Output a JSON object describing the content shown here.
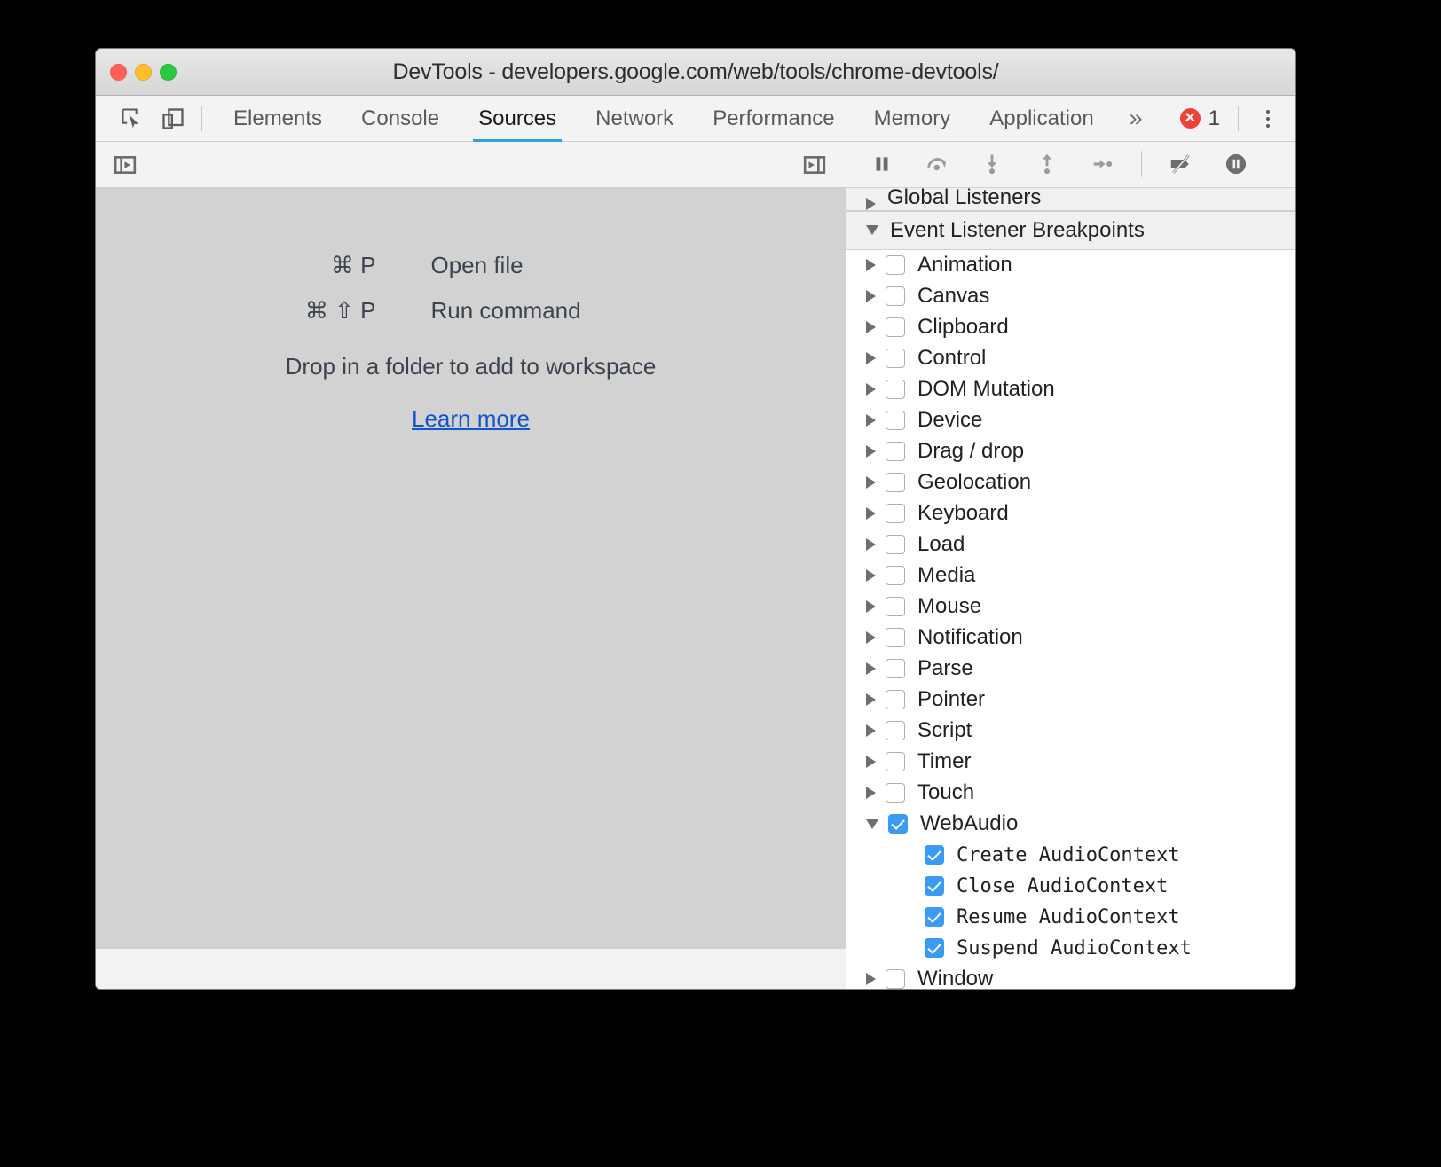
{
  "window": {
    "title": "DevTools - developers.google.com/web/tools/chrome-devtools/",
    "traffic_lights": [
      "close",
      "minimize",
      "maximize"
    ]
  },
  "colors": {
    "accent": "#29a3e0",
    "error": "#ef4136",
    "checkbox": "#3a9bf5",
    "link": "#1155cc"
  },
  "toolbar": {
    "inspect_icon": "inspect-element-icon",
    "device_icon": "device-toolbar-icon",
    "tabs": [
      {
        "label": "Elements",
        "active": false
      },
      {
        "label": "Console",
        "active": false
      },
      {
        "label": "Sources",
        "active": true
      },
      {
        "label": "Network",
        "active": false
      },
      {
        "label": "Performance",
        "active": false
      },
      {
        "label": "Memory",
        "active": false
      },
      {
        "label": "Application",
        "active": false
      }
    ],
    "more_tabs_label": "»",
    "error_count": "1",
    "error_icon": "error-circle-icon",
    "menu_icon": "kebab-menu-icon"
  },
  "editor": {
    "toolbar": {
      "show_navigator_icon": "show-navigator-panel-icon",
      "show_debugger_icon": "show-debugger-panel-icon"
    },
    "shortcuts": [
      {
        "keys": "⌘ P",
        "desc": "Open file"
      },
      {
        "keys": "⌘ ⇧ P",
        "desc": "Run command"
      }
    ],
    "drop_note": "Drop in a folder to add to workspace",
    "learn_more": "Learn more"
  },
  "debugger": {
    "buttons": [
      {
        "name": "resume-script-execution",
        "icon": "pause-icon"
      },
      {
        "name": "step-over-next-function-call",
        "icon": "step-over-icon"
      },
      {
        "name": "step-into-next-function-call",
        "icon": "step-into-icon"
      },
      {
        "name": "step-out-of-current-function",
        "icon": "step-out-icon"
      },
      {
        "name": "step",
        "icon": "step-icon"
      },
      {
        "name": "deactivate-breakpoints",
        "icon": "deactivate-breakpoints-icon"
      },
      {
        "name": "pause-on-exceptions",
        "icon": "pause-on-exceptions-icon"
      }
    ],
    "sections": [
      {
        "label": "Global Listeners",
        "expanded": false,
        "clipped": true
      },
      {
        "label": "Event Listener Breakpoints",
        "expanded": true,
        "clipped": false
      }
    ],
    "event_breakpoints": [
      {
        "label": "Animation",
        "checked": false,
        "expanded": false,
        "children": []
      },
      {
        "label": "Canvas",
        "checked": false,
        "expanded": false,
        "children": []
      },
      {
        "label": "Clipboard",
        "checked": false,
        "expanded": false,
        "children": []
      },
      {
        "label": "Control",
        "checked": false,
        "expanded": false,
        "children": []
      },
      {
        "label": "DOM Mutation",
        "checked": false,
        "expanded": false,
        "children": []
      },
      {
        "label": "Device",
        "checked": false,
        "expanded": false,
        "children": []
      },
      {
        "label": "Drag / drop",
        "checked": false,
        "expanded": false,
        "children": []
      },
      {
        "label": "Geolocation",
        "checked": false,
        "expanded": false,
        "children": []
      },
      {
        "label": "Keyboard",
        "checked": false,
        "expanded": false,
        "children": []
      },
      {
        "label": "Load",
        "checked": false,
        "expanded": false,
        "children": []
      },
      {
        "label": "Media",
        "checked": false,
        "expanded": false,
        "children": []
      },
      {
        "label": "Mouse",
        "checked": false,
        "expanded": false,
        "children": []
      },
      {
        "label": "Notification",
        "checked": false,
        "expanded": false,
        "children": []
      },
      {
        "label": "Parse",
        "checked": false,
        "expanded": false,
        "children": []
      },
      {
        "label": "Pointer",
        "checked": false,
        "expanded": false,
        "children": []
      },
      {
        "label": "Script",
        "checked": false,
        "expanded": false,
        "children": []
      },
      {
        "label": "Timer",
        "checked": false,
        "expanded": false,
        "children": []
      },
      {
        "label": "Touch",
        "checked": false,
        "expanded": false,
        "children": []
      },
      {
        "label": "WebAudio",
        "checked": true,
        "expanded": true,
        "children": [
          {
            "label": "Create AudioContext",
            "checked": true
          },
          {
            "label": "Close AudioContext",
            "checked": true
          },
          {
            "label": "Resume AudioContext",
            "checked": true
          },
          {
            "label": "Suspend AudioContext",
            "checked": true
          }
        ]
      },
      {
        "label": "Window",
        "checked": false,
        "expanded": false,
        "children": []
      }
    ]
  }
}
